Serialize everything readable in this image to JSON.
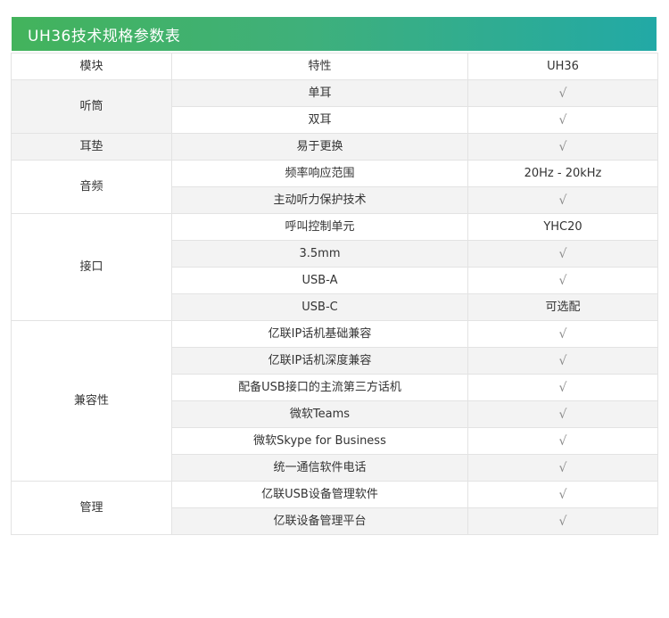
{
  "title": "UH36技术规格参数表",
  "header": {
    "module": "模块",
    "feature": "特性",
    "model": "UH36"
  },
  "groups": [
    {
      "name": "听筒",
      "rows": [
        {
          "feature": "单耳",
          "value": "√"
        },
        {
          "feature": "双耳",
          "value": "√"
        }
      ]
    },
    {
      "name": "耳垫",
      "rows": [
        {
          "feature": "易于更换",
          "value": "√"
        }
      ]
    },
    {
      "name": "音频",
      "rows": [
        {
          "feature": "频率响应范围",
          "value": "20Hz - 20kHz"
        },
        {
          "feature": "主动听力保护技术",
          "value": "√"
        }
      ]
    },
    {
      "name": "接口",
      "rows": [
        {
          "feature": "呼叫控制单元",
          "value": "YHC20"
        },
        {
          "feature": "3.5mm",
          "value": "√"
        },
        {
          "feature": "USB-A",
          "value": "√"
        },
        {
          "feature": "USB-C",
          "value": "可选配"
        }
      ]
    },
    {
      "name": "兼容性",
      "rows": [
        {
          "feature": "亿联IP话机基础兼容",
          "value": "√"
        },
        {
          "feature": "亿联IP话机深度兼容",
          "value": "√"
        },
        {
          "feature": "配备USB接口的主流第三方话机",
          "value": "√"
        },
        {
          "feature": "微软Teams",
          "value": "√"
        },
        {
          "feature": "微软Skype for Business",
          "value": "√"
        },
        {
          "feature": "统一通信软件电话",
          "value": "√"
        }
      ]
    },
    {
      "name": "管理",
      "rows": [
        {
          "feature": "亿联USB设备管理软件",
          "value": "√"
        },
        {
          "feature": "亿联设备管理平台",
          "value": "√"
        }
      ]
    }
  ],
  "colors": {
    "banner_start": "#43b35c",
    "banner_end": "#22a9a6",
    "row_shade": "#f3f3f3",
    "border": "#e3e3e3"
  }
}
